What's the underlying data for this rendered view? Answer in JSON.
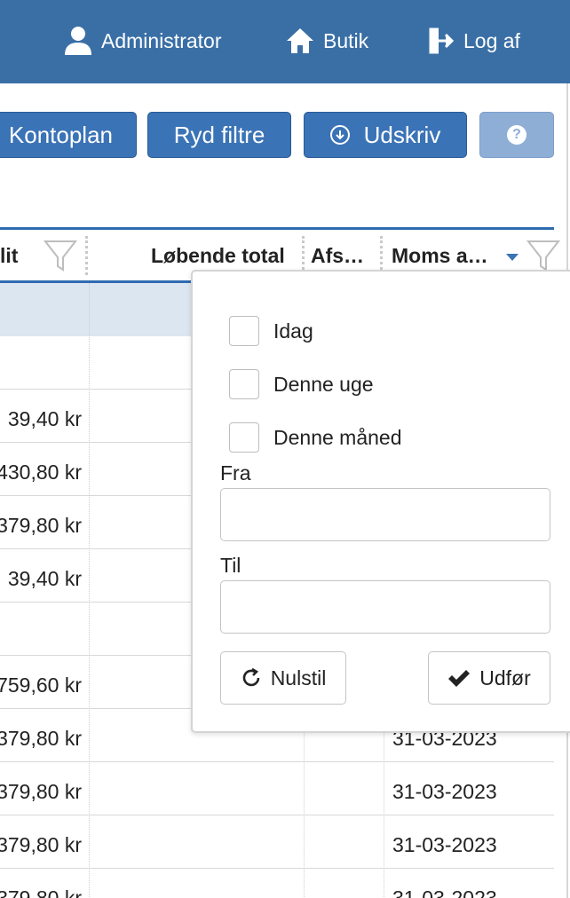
{
  "header": {
    "admin_label": "Administrator",
    "shop_label": "Butik",
    "logout_label": "Log af",
    "color": "#3a6fa6"
  },
  "toolbar": {
    "kontoplan_label": "Kontoplan",
    "clear_filters_label": "Ryd filtre",
    "print_label": "Udskriv",
    "help_label": "?"
  },
  "grid": {
    "columns": {
      "credit_partial": "lit",
      "running_total": "Løbende total",
      "afs": "Afs…",
      "moms": "Moms a…"
    },
    "amounts": [
      "39,40 kr",
      "430,80 kr",
      "379,80 kr",
      "39,40 kr",
      "",
      "759,60 kr",
      "379,80 kr",
      "379,80 kr",
      "379,80 kr",
      "379,80 kr"
    ],
    "dates": [
      "31-03-2023",
      "31-03-2023",
      "31-03-2023",
      "31-03-2023"
    ]
  },
  "filter_popup": {
    "today_label": "Idag",
    "this_week_label": "Denne uge",
    "this_month_label": "Denne måned",
    "from_label": "Fra",
    "to_label": "Til",
    "from_value": "",
    "to_value": "",
    "reset_label": "Nulstil",
    "apply_label": "Udfør"
  }
}
